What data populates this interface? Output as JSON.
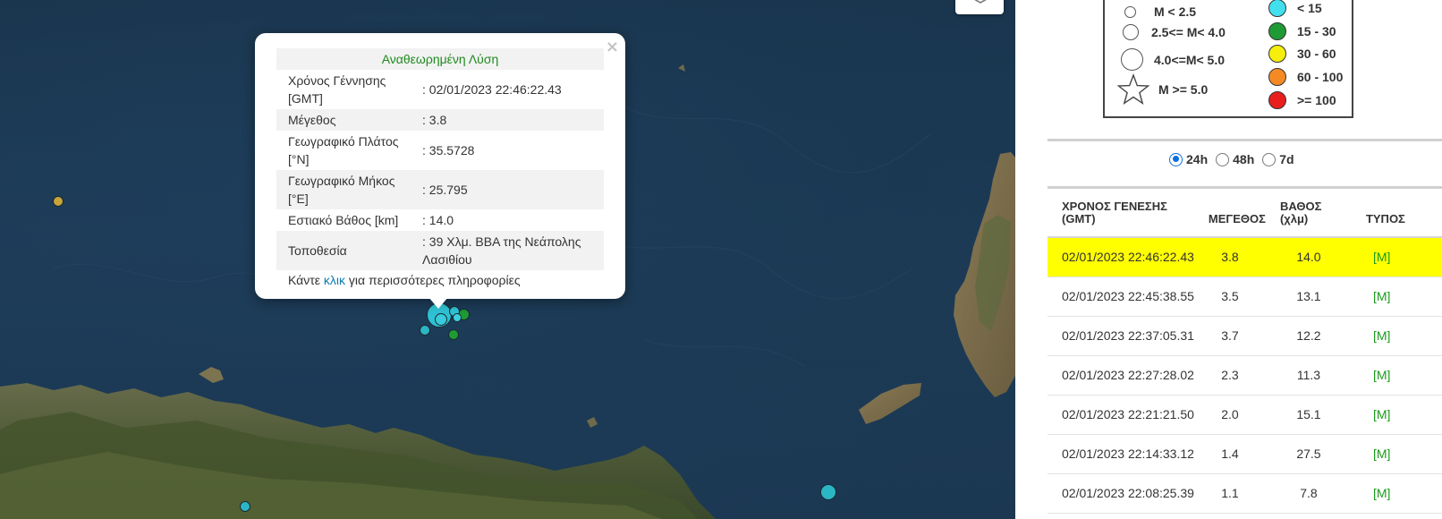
{
  "popup": {
    "title": "Αναθεωρημένη Λύση",
    "close": "×",
    "rows": [
      {
        "key": "Χρόνος Γέννησης [GMT]",
        "value": ": 02/01/2023 22:46:22.43"
      },
      {
        "key": "Μέγεθος",
        "value": ": 3.8"
      },
      {
        "key": "Γεωγραφικό Πλάτος [°N]",
        "value": ": 35.5728"
      },
      {
        "key": "Γεωγραφικό Μήκος [°E]",
        "value": ": 25.795"
      },
      {
        "key": "Εστιακό Βάθος [km]",
        "value": ": 14.0"
      },
      {
        "key": "Τοποθεσία",
        "value": ": 39 Χλμ. ΒΒΑ της Νεάπολης Λασιθίου"
      }
    ],
    "more_prefix": "Κάντε ",
    "more_link": "κλικ",
    "more_suffix": " για περισσότερες πληροφορίες"
  },
  "legend": {
    "magnitude": [
      "M < 2.5",
      "2.5<= M< 4.0",
      "4.0<=M< 5.0",
      "M >= 5.0"
    ],
    "depth": [
      {
        "label": "< 15",
        "color": "#42e0ee"
      },
      {
        "label": "15 - 30",
        "color": "#1f9a35"
      },
      {
        "label": "30 - 60",
        "color": "#f6ee0c"
      },
      {
        "label": "60 - 100",
        "color": "#f58a24"
      },
      {
        "label": ">= 100",
        "color": "#e91e1e"
      }
    ]
  },
  "range": {
    "options": [
      "24h",
      "48h",
      "7d"
    ],
    "selected": "24h"
  },
  "table": {
    "headers": {
      "time": "ΧΡΟΝΟΣ ΓΕΝΕΣΗΣ (GMT)",
      "mag": "ΜΕΓΕΘΟΣ",
      "depth": "ΒΑΘΟΣ (χλμ)",
      "type": "ΤΥΠΟΣ"
    },
    "rows": [
      {
        "time": "02/01/2023 22:46:22.43",
        "mag": "3.8",
        "depth": "14.0",
        "type": "[M]"
      },
      {
        "time": "02/01/2023 22:45:38.55",
        "mag": "3.5",
        "depth": "13.1",
        "type": "[M]"
      },
      {
        "time": "02/01/2023 22:37:05.31",
        "mag": "3.7",
        "depth": "12.2",
        "type": "[M]"
      },
      {
        "time": "02/01/2023 22:27:28.02",
        "mag": "2.3",
        "depth": "11.3",
        "type": "[M]"
      },
      {
        "time": "02/01/2023 22:21:21.50",
        "mag": "2.0",
        "depth": "15.1",
        "type": "[M]"
      },
      {
        "time": "02/01/2023 22:14:33.12",
        "mag": "1.4",
        "depth": "27.5",
        "type": "[M]"
      },
      {
        "time": "02/01/2023 22:08:25.39",
        "mag": "1.1",
        "depth": "7.8",
        "type": "[M]"
      }
    ],
    "selected_row": 0,
    "highlight_color": "#ffff00"
  },
  "colors": {
    "popup_title": "#1f8a1f",
    "link": "#0e7bb4",
    "type_green": "#1c9a1c"
  }
}
